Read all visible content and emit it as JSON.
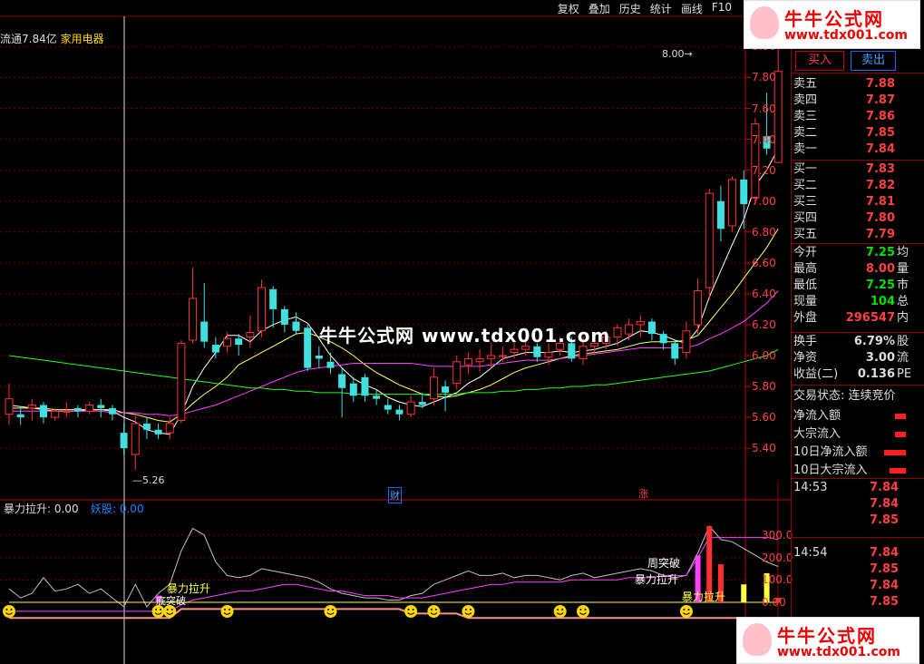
{
  "menu": [
    "复权",
    "叠加",
    "历史",
    "统计",
    "画线",
    "F10"
  ],
  "stock": {
    "float_label": "流通7.84亿",
    "industry": "家用电器"
  },
  "logo": {
    "name": "牛牛公式网",
    "url": "www.tdx001.com"
  },
  "watermark": "牛牛公式网  www.tdx001.com",
  "panel": {
    "buy_btn": "买入",
    "sell_btn": "卖出",
    "asks": [
      {
        "label": "卖五",
        "price": "7.88"
      },
      {
        "label": "卖四",
        "price": "7.87"
      },
      {
        "label": "卖三",
        "price": "7.86"
      },
      {
        "label": "卖二",
        "price": "7.85"
      },
      {
        "label": "卖一",
        "price": "7.84"
      }
    ],
    "bids": [
      {
        "label": "买一",
        "price": "7.83"
      },
      {
        "label": "买二",
        "price": "7.82"
      },
      {
        "label": "买三",
        "price": "7.81"
      },
      {
        "label": "买四",
        "price": "7.80"
      },
      {
        "label": "买五",
        "price": "7.79"
      }
    ],
    "stats": [
      {
        "label": "今开",
        "value": "7.25",
        "x": "均"
      },
      {
        "label": "最高",
        "value": "8.00",
        "x": "量"
      },
      {
        "label": "最低",
        "value": "7.25",
        "x": "市"
      },
      {
        "label": "现量",
        "value": "104",
        "x": "总"
      },
      {
        "label": "外盘",
        "value": "296547",
        "x": "内"
      }
    ],
    "stats2": [
      {
        "label": "换手",
        "value": "6.79%",
        "x": "股"
      },
      {
        "label": "净资",
        "value": "3.00",
        "x": "流"
      },
      {
        "label": "收益(二)",
        "value": "0.136",
        "x": "PE"
      }
    ],
    "trade_state": "交易状态: 连续竞价",
    "flows": [
      "净流入额",
      "大宗流入",
      "10日净流入额",
      "10日大宗流入"
    ],
    "ticks": [
      {
        "time": "14:53",
        "prices": [
          "7.84",
          "7.84",
          "7.85"
        ]
      },
      {
        "time": "14:54",
        "prices": [
          "7.84",
          "7.85",
          "7.84",
          "7.85"
        ]
      }
    ]
  },
  "annotations": {
    "low": "5.26",
    "high": "8.00",
    "marker_cai": "财",
    "marker_zhang": "涨",
    "sub_label": "暴力拉升: 0.00",
    "sub_label2": "妖股: 0.00",
    "signal1": "暴力拉升",
    "signal2": "暴力拉升",
    "signal3": "周突破",
    "signal4": "暴力拉升",
    "signal5": "底突破"
  },
  "chart_data": {
    "type": "candlestick",
    "price_axis": [
      "8.00",
      "7.80",
      "7.60",
      "7.40",
      "7.20",
      "7.00",
      "6.80",
      "6.60",
      "6.40",
      "6.20",
      "6.00",
      "5.80",
      "5.60",
      "5.40"
    ],
    "ylim": [
      5.26,
      8.02
    ],
    "sub_axis": [
      "300.0",
      "200.0",
      "100.0",
      "0.00"
    ],
    "sub_ylim": [
      0,
      340
    ],
    "candles": [
      {
        "o": 5.62,
        "c": 5.72,
        "h": 5.82,
        "l": 5.55
      },
      {
        "o": 5.62,
        "c": 5.6,
        "h": 5.67,
        "l": 5.55
      },
      {
        "o": 5.66,
        "c": 5.68,
        "h": 5.72,
        "l": 5.58
      },
      {
        "o": 5.68,
        "c": 5.6,
        "h": 5.7,
        "l": 5.56
      },
      {
        "o": 5.6,
        "c": 5.64,
        "h": 5.66,
        "l": 5.58
      },
      {
        "o": 5.64,
        "c": 5.64,
        "h": 5.7,
        "l": 5.6
      },
      {
        "o": 5.66,
        "c": 5.64,
        "h": 5.68,
        "l": 5.6
      },
      {
        "o": 5.64,
        "c": 5.68,
        "h": 5.7,
        "l": 5.62
      },
      {
        "o": 5.68,
        "c": 5.66,
        "h": 5.72,
        "l": 5.6
      },
      {
        "o": 5.66,
        "c": 5.62,
        "h": 5.68,
        "l": 5.58
      },
      {
        "o": 5.5,
        "c": 5.4,
        "h": 5.56,
        "l": 5.36
      },
      {
        "o": 5.36,
        "c": 5.56,
        "h": 5.62,
        "l": 5.26
      },
      {
        "o": 5.56,
        "c": 5.52,
        "h": 5.6,
        "l": 5.46
      },
      {
        "o": 5.52,
        "c": 5.49,
        "h": 5.56,
        "l": 5.46
      },
      {
        "o": 5.5,
        "c": 5.56,
        "h": 5.6,
        "l": 5.46
      },
      {
        "o": 5.58,
        "c": 6.08,
        "h": 6.1,
        "l": 5.56
      },
      {
        "o": 6.1,
        "c": 6.37,
        "h": 6.57,
        "l": 6.08
      },
      {
        "o": 6.22,
        "c": 6.09,
        "h": 6.47,
        "l": 6.05
      },
      {
        "o": 6.07,
        "c": 6.02,
        "h": 6.12,
        "l": 5.98
      },
      {
        "o": 6.06,
        "c": 6.11,
        "h": 6.15,
        "l": 6.02
      },
      {
        "o": 6.11,
        "c": 6.07,
        "h": 6.14,
        "l": 6.0
      },
      {
        "o": 6.12,
        "c": 6.15,
        "h": 6.26,
        "l": 6.05
      },
      {
        "o": 6.16,
        "c": 6.44,
        "h": 6.49,
        "l": 6.12
      },
      {
        "o": 6.43,
        "c": 6.3,
        "h": 6.45,
        "l": 6.18
      },
      {
        "o": 6.3,
        "c": 6.2,
        "h": 6.32,
        "l": 6.15
      },
      {
        "o": 6.22,
        "c": 6.16,
        "h": 6.28,
        "l": 6.14
      },
      {
        "o": 6.18,
        "c": 5.92,
        "h": 6.2,
        "l": 5.9
      },
      {
        "o": 6.0,
        "c": 5.98,
        "h": 6.06,
        "l": 5.92
      },
      {
        "o": 5.96,
        "c": 5.92,
        "h": 6.02,
        "l": 5.88
      },
      {
        "o": 5.88,
        "c": 5.79,
        "h": 5.92,
        "l": 5.6
      },
      {
        "o": 5.82,
        "c": 5.74,
        "h": 5.86,
        "l": 5.7
      },
      {
        "o": 5.86,
        "c": 5.74,
        "h": 5.88,
        "l": 5.7
      },
      {
        "o": 5.74,
        "c": 5.72,
        "h": 5.78,
        "l": 5.68
      },
      {
        "o": 5.68,
        "c": 5.65,
        "h": 5.72,
        "l": 5.62
      },
      {
        "o": 5.65,
        "c": 5.62,
        "h": 5.68,
        "l": 5.58
      },
      {
        "o": 5.62,
        "c": 5.7,
        "h": 5.74,
        "l": 5.6
      },
      {
        "o": 5.7,
        "c": 5.68,
        "h": 5.76,
        "l": 5.66
      },
      {
        "o": 5.72,
        "c": 5.86,
        "h": 5.92,
        "l": 5.68
      },
      {
        "o": 5.8,
        "c": 5.76,
        "h": 5.84,
        "l": 5.64
      },
      {
        "o": 5.82,
        "c": 5.96,
        "h": 6.0,
        "l": 5.78
      },
      {
        "o": 5.94,
        "c": 5.98,
        "h": 6.02,
        "l": 5.88
      },
      {
        "o": 5.96,
        "c": 5.98,
        "h": 6.04,
        "l": 5.9
      },
      {
        "o": 5.98,
        "c": 6.0,
        "h": 6.08,
        "l": 5.92
      },
      {
        "o": 6.0,
        "c": 6.0,
        "h": 6.06,
        "l": 5.96
      },
      {
        "o": 6.02,
        "c": 6.04,
        "h": 6.1,
        "l": 5.98
      },
      {
        "o": 6.04,
        "c": 6.06,
        "h": 6.1,
        "l": 6.0
      },
      {
        "o": 6.06,
        "c": 5.99,
        "h": 6.08,
        "l": 5.96
      },
      {
        "o": 5.99,
        "c": 6.02,
        "h": 6.08,
        "l": 5.94
      },
      {
        "o": 6.04,
        "c": 6.08,
        "h": 6.12,
        "l": 6.0
      },
      {
        "o": 6.08,
        "c": 5.98,
        "h": 6.12,
        "l": 5.96
      },
      {
        "o": 5.98,
        "c": 6.06,
        "h": 6.12,
        "l": 5.94
      },
      {
        "o": 6.06,
        "c": 6.08,
        "h": 6.14,
        "l": 6.02
      },
      {
        "o": 6.08,
        "c": 6.12,
        "h": 6.16,
        "l": 6.04
      },
      {
        "o": 6.12,
        "c": 6.18,
        "h": 6.2,
        "l": 6.06
      },
      {
        "o": 6.14,
        "c": 6.2,
        "h": 6.24,
        "l": 6.1
      },
      {
        "o": 6.2,
        "c": 6.22,
        "h": 6.26,
        "l": 6.12
      },
      {
        "o": 6.22,
        "c": 6.14,
        "h": 6.24,
        "l": 6.1
      },
      {
        "o": 6.14,
        "c": 6.08,
        "h": 6.16,
        "l": 6.04
      },
      {
        "o": 6.08,
        "c": 5.98,
        "h": 6.1,
        "l": 5.94
      },
      {
        "o": 6.02,
        "c": 6.16,
        "h": 6.22,
        "l": 5.98
      },
      {
        "o": 6.2,
        "c": 6.42,
        "h": 6.5,
        "l": 6.14
      },
      {
        "o": 6.44,
        "c": 7.05,
        "h": 7.08,
        "l": 6.36
      },
      {
        "o": 7.0,
        "c": 6.82,
        "h": 7.1,
        "l": 6.74
      },
      {
        "o": 6.84,
        "c": 7.14,
        "h": 7.16,
        "l": 6.8
      },
      {
        "o": 7.14,
        "c": 6.98,
        "h": 7.2,
        "l": 6.82
      },
      {
        "o": 7.02,
        "c": 7.5,
        "h": 7.54,
        "l": 6.98
      },
      {
        "o": 7.42,
        "c": 7.34,
        "h": 7.7,
        "l": 7.3
      },
      {
        "o": 7.25,
        "c": 7.84,
        "h": 8.0,
        "l": 7.25
      }
    ],
    "ma": [
      {
        "name": "MA5",
        "color": "#ffffff",
        "values": [
          5.68,
          5.67,
          5.66,
          5.65,
          5.64,
          5.64,
          5.64,
          5.65,
          5.65,
          5.64,
          5.6,
          5.57,
          5.52,
          5.5,
          5.49,
          5.62,
          5.8,
          5.92,
          6.02,
          6.13,
          6.13,
          6.09,
          6.16,
          6.2,
          6.23,
          6.25,
          6.21,
          6.11,
          6.0,
          5.92,
          5.85,
          5.81,
          5.78,
          5.73,
          5.7,
          5.68,
          5.67,
          5.7,
          5.73,
          5.76,
          5.82,
          5.86,
          5.92,
          5.98,
          6.0,
          6.02,
          6.02,
          6.02,
          6.03,
          6.02,
          6.03,
          6.04,
          6.06,
          6.08,
          6.12,
          6.16,
          6.15,
          6.13,
          6.1,
          6.08,
          6.17,
          6.38,
          6.55,
          6.72,
          6.88,
          7.1,
          7.2,
          7.34
        ]
      },
      {
        "name": "MA10",
        "color": "#ffff60",
        "values": [
          5.66,
          5.66,
          5.66,
          5.66,
          5.65,
          5.65,
          5.65,
          5.65,
          5.65,
          5.65,
          5.63,
          5.62,
          5.6,
          5.58,
          5.57,
          5.62,
          5.69,
          5.75,
          5.8,
          5.86,
          5.94,
          5.98,
          6.02,
          6.06,
          6.1,
          6.14,
          6.15,
          6.12,
          6.09,
          6.05,
          6.0,
          5.94,
          5.89,
          5.85,
          5.81,
          5.78,
          5.75,
          5.74,
          5.73,
          5.74,
          5.76,
          5.78,
          5.81,
          5.85,
          5.89,
          5.92,
          5.94,
          5.96,
          5.98,
          6.0,
          6.01,
          6.02,
          6.03,
          6.04,
          6.06,
          6.08,
          6.09,
          6.09,
          6.09,
          6.1,
          6.13,
          6.22,
          6.31,
          6.4,
          6.5,
          6.6,
          6.7,
          6.82
        ]
      },
      {
        "name": "MA20",
        "color": "#ff40ff",
        "values": [
          5.64,
          5.64,
          5.64,
          5.64,
          5.64,
          5.64,
          5.64,
          5.64,
          5.64,
          5.63,
          5.63,
          5.63,
          5.62,
          5.62,
          5.61,
          5.62,
          5.64,
          5.66,
          5.68,
          5.71,
          5.74,
          5.77,
          5.8,
          5.83,
          5.86,
          5.89,
          5.91,
          5.92,
          5.93,
          5.94,
          5.95,
          5.95,
          5.95,
          5.95,
          5.95,
          5.95,
          5.94,
          5.93,
          5.93,
          5.93,
          5.93,
          5.93,
          5.94,
          5.95,
          5.96,
          5.97,
          5.97,
          5.97,
          5.98,
          5.99,
          6.0,
          6.01,
          6.02,
          6.03,
          6.04,
          6.05,
          6.05,
          6.05,
          6.05,
          6.05,
          6.07,
          6.11,
          6.14,
          6.18,
          6.22,
          6.28,
          6.34,
          6.42
        ]
      },
      {
        "name": "MA60",
        "color": "#20ff20",
        "values": [
          6.0,
          5.99,
          5.98,
          5.97,
          5.96,
          5.95,
          5.94,
          5.93,
          5.92,
          5.91,
          5.9,
          5.89,
          5.88,
          5.87,
          5.86,
          5.85,
          5.84,
          5.83,
          5.82,
          5.81,
          5.8,
          5.79,
          5.79,
          5.78,
          5.78,
          5.77,
          5.77,
          5.76,
          5.76,
          5.76,
          5.75,
          5.75,
          5.75,
          5.75,
          5.75,
          5.75,
          5.75,
          5.75,
          5.75,
          5.75,
          5.76,
          5.76,
          5.76,
          5.77,
          5.77,
          5.78,
          5.78,
          5.79,
          5.79,
          5.8,
          5.8,
          5.81,
          5.81,
          5.82,
          5.83,
          5.84,
          5.85,
          5.86,
          5.87,
          5.88,
          5.89,
          5.9,
          5.92,
          5.94,
          5.96,
          5.98,
          6.0,
          6.04
        ]
      }
    ],
    "sub_series": [
      {
        "name": "line-grey",
        "color": "#c0c0c0",
        "values": [
          60,
          20,
          40,
          110,
          50,
          60,
          80,
          40,
          60,
          20,
          -20,
          80,
          -20,
          40,
          80,
          230,
          330,
          300,
          180,
          120,
          110,
          120,
          150,
          140,
          130,
          120,
          110,
          90,
          60,
          40,
          30,
          20,
          20,
          10,
          10,
          30,
          40,
          80,
          100,
          120,
          140,
          120,
          120,
          130,
          110,
          120,
          120,
          110,
          100,
          120,
          130,
          110,
          120,
          130,
          140,
          150,
          140,
          120,
          110,
          120,
          220,
          340,
          280,
          270,
          240,
          210,
          180,
          160
        ]
      },
      {
        "name": "line-magenta",
        "color": "#ff40ff",
        "values": [
          -40,
          -40,
          -40,
          -40,
          -40,
          -40,
          -40,
          -40,
          -40,
          -40,
          -40,
          -40,
          -40,
          -40,
          -40,
          -10,
          10,
          20,
          30,
          40,
          50,
          50,
          60,
          70,
          80,
          80,
          70,
          60,
          50,
          50,
          40,
          30,
          30,
          30,
          20,
          20,
          20,
          30,
          40,
          50,
          60,
          70,
          80,
          80,
          90,
          90,
          90,
          90,
          90,
          100,
          100,
          100,
          100,
          100,
          110,
          110,
          110,
          120,
          120,
          120,
          200,
          290,
          290,
          290,
          290,
          290,
          290,
          280
        ]
      },
      {
        "name": "line-pink",
        "color": "#ff9090",
        "values": [
          -70,
          -70,
          -70,
          -70,
          -70,
          -70,
          -70,
          -70,
          -70,
          -70,
          -70,
          -70,
          -70,
          -70,
          -70,
          -30,
          -30,
          -30,
          -30,
          -30,
          -30,
          -30,
          -30,
          -30,
          -30,
          -30,
          -30,
          -30,
          -30,
          -30,
          -30,
          -30,
          -30,
          -30,
          -30,
          -50,
          -50,
          -50,
          -50,
          -50,
          -70,
          -70,
          -70,
          -70,
          -70,
          -70,
          -70,
          -70,
          -70,
          -70,
          -70,
          -70,
          -70,
          -70,
          -70,
          -70,
          -70,
          -70,
          -70,
          -70,
          -70,
          -70,
          -70,
          -70,
          -70,
          -70,
          -70,
          -70
        ]
      },
      {
        "name": "line-yellow",
        "color": "#ffff40",
        "values": [
          0,
          0,
          0,
          0,
          0,
          0,
          0,
          0,
          0,
          0,
          0,
          0,
          0,
          0,
          0,
          0,
          0,
          0,
          0,
          0,
          0,
          0,
          0,
          0,
          0,
          0,
          0,
          0,
          0,
          0,
          0,
          0,
          0,
          0,
          0,
          0,
          0,
          0,
          0,
          0,
          0,
          0,
          0,
          0,
          0,
          0,
          0,
          0,
          0,
          0,
          0,
          0,
          0,
          0,
          0,
          0,
          0,
          0,
          0,
          0,
          0,
          0,
          0,
          0,
          0,
          0,
          0,
          0
        ]
      }
    ],
    "smiley_idx": [
      0,
      13,
      14,
      19,
      28,
      35,
      37,
      40,
      48,
      50,
      59
    ]
  }
}
